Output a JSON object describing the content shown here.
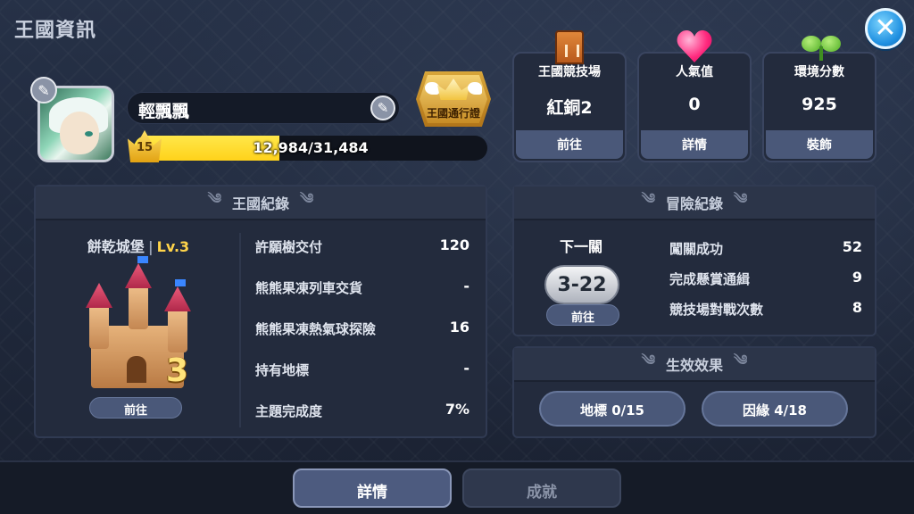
{
  "header": {
    "title": "王國資訊",
    "close_icon": "close-icon"
  },
  "profile": {
    "name": "輕飄飄",
    "level": "15",
    "xp_text": "12,984/31,484",
    "xp_fraction": 0.412,
    "pass_label": "王國通行證"
  },
  "stats": [
    {
      "icon": "arena-tower-icon",
      "label": "王國競技場",
      "value": "紅銅2",
      "button": "前往"
    },
    {
      "icon": "heart-icon",
      "label": "人氣值",
      "value": "0",
      "button": "詳情"
    },
    {
      "icon": "clover-icon",
      "label": "環境分數",
      "value": "925",
      "button": "裝飾"
    }
  ],
  "kingdom_record": {
    "title": "王國紀錄",
    "castle_name": "餅乾城堡",
    "castle_level": "Lv.3",
    "castle_level_number": "3",
    "go_label": "前往",
    "rows": [
      {
        "label": "許願樹交付",
        "value": "120"
      },
      {
        "label": "熊熊果凍列車交貨",
        "value": "-"
      },
      {
        "label": "熊熊果凍熱氣球探險",
        "value": "16"
      },
      {
        "label": "持有地標",
        "value": "-"
      },
      {
        "label": "主題完成度",
        "value": "7%"
      }
    ]
  },
  "adventure_record": {
    "title": "冒險紀錄",
    "next_label": "下一關",
    "next_stage": "3-22",
    "go_label": "前往",
    "rows": [
      {
        "label": "闖關成功",
        "value": "52"
      },
      {
        "label": "完成懸賞通緝",
        "value": "9"
      },
      {
        "label": "競技場對戰次數",
        "value": "8"
      }
    ]
  },
  "effects": {
    "title": "生效效果",
    "landmark": "地標 0/15",
    "bond": "因緣 4/18"
  },
  "bottom_tabs": {
    "details": "詳情",
    "achievements": "成就"
  },
  "colors": {
    "xp_fill": "#ffd21a",
    "castle_level": "#ffd44a",
    "close_button": "#1e8fe0"
  }
}
